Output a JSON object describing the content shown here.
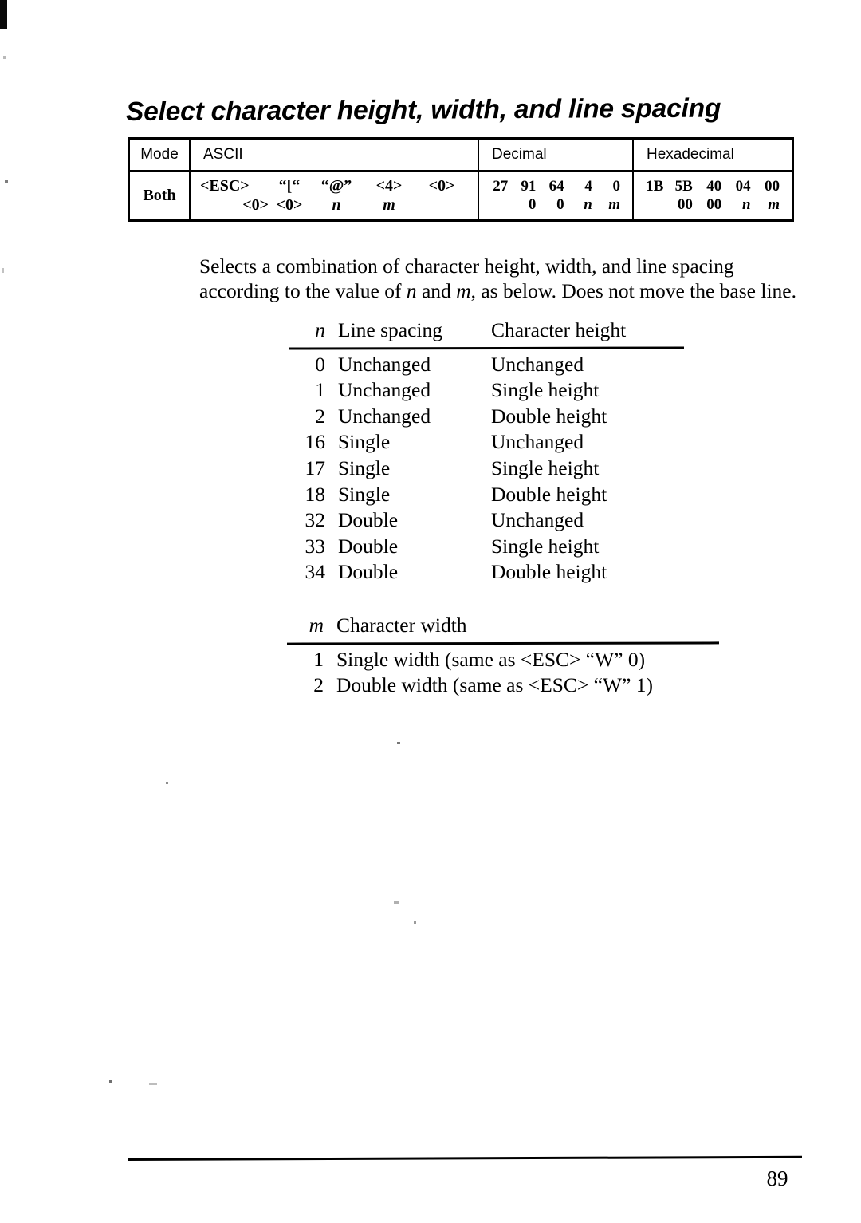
{
  "page": {
    "title": "Select character height, width, and line spacing",
    "number": "89"
  },
  "command_table": {
    "headers": {
      "mode": "Mode",
      "ascii": "ASCII",
      "decimal": "Decimal",
      "hexadecimal": "Hexadecimal"
    },
    "row": {
      "mode": "Both",
      "ascii_line1": [
        "<ESC>",
        "“[“",
        "“@”",
        "<4>",
        "<0>"
      ],
      "ascii_line2": [
        "<0>",
        "<0>",
        "n",
        "m"
      ],
      "decimal_line1": [
        "27",
        "91",
        "64",
        "4",
        "0"
      ],
      "decimal_line2": [
        "0",
        "0",
        "n",
        "m"
      ],
      "hex_line1": [
        "1B",
        "5B",
        "40",
        "04",
        "00"
      ],
      "hex_line2": [
        "00",
        "00",
        "n",
        "m"
      ]
    }
  },
  "description": {
    "line1_a": "Selects a combination of character height, width, and line spacing",
    "line2_a": "according to the value of ",
    "line2_n": "n",
    "line2_b": " and ",
    "line2_m": "m",
    "line2_c": ", as below. Does not move the base",
    "line3": "line."
  },
  "n_table": {
    "headers": {
      "key": "n",
      "mid": "Line spacing",
      "last": "Character height"
    },
    "rows": [
      {
        "key": "0",
        "mid": "Unchanged",
        "last": "Unchanged"
      },
      {
        "key": "1",
        "mid": "Unchanged",
        "last": "Single height"
      },
      {
        "key": "2",
        "mid": "Unchanged",
        "last": "Double height"
      },
      {
        "key": "16",
        "mid": "Single",
        "last": "Unchanged"
      },
      {
        "key": "17",
        "mid": "Single",
        "last": "Single height"
      },
      {
        "key": "18",
        "mid": "Single",
        "last": "Double height"
      },
      {
        "key": "32",
        "mid": "Double",
        "last": "Unchanged"
      },
      {
        "key": "33",
        "mid": "Double",
        "last": "Single height"
      },
      {
        "key": "34",
        "mid": "Double",
        "last": "Double height"
      }
    ]
  },
  "m_table": {
    "headers": {
      "key": "m",
      "mid": "Character width"
    },
    "rows": [
      {
        "key": "1",
        "mid": "Single width (same as <ESC> “W” 0)"
      },
      {
        "key": "2",
        "mid": "Double width (same as <ESC> “W” 1)"
      }
    ]
  }
}
